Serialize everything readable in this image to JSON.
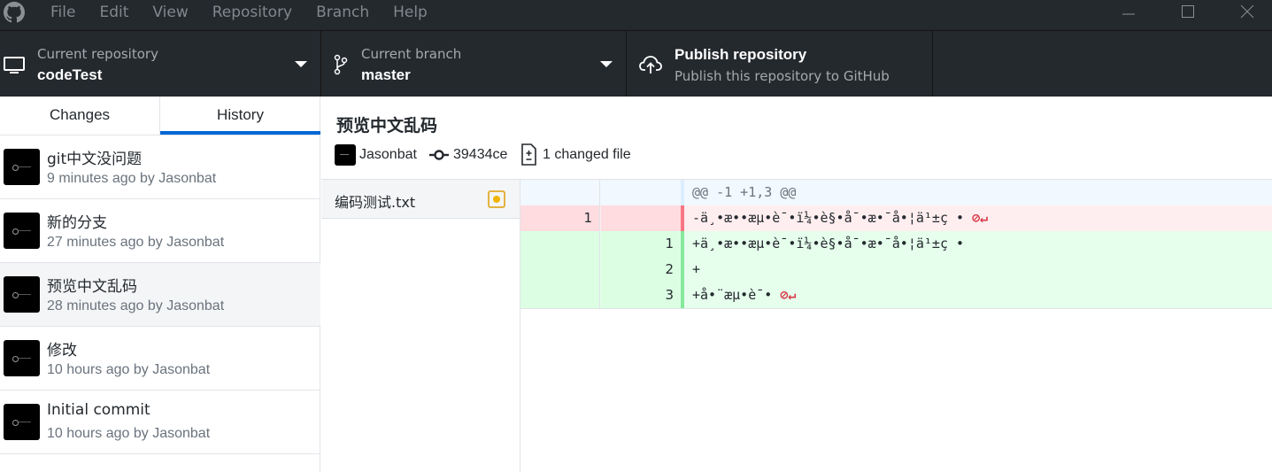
{
  "menu": {
    "items": [
      "File",
      "Edit",
      "View",
      "Repository",
      "Branch",
      "Help"
    ]
  },
  "window_controls": [
    "minimize-icon",
    "maximize-icon",
    "close-icon"
  ],
  "toolbar": {
    "repository": {
      "label": "Current repository",
      "value": "codeTest"
    },
    "branch": {
      "label": "Current branch",
      "value": "master"
    },
    "publish": {
      "label": "Publish repository",
      "sublabel": "Publish this repository to GitHub"
    }
  },
  "tabs": [
    "Changes",
    "History"
  ],
  "active_tab": "History",
  "commits": [
    {
      "title": "git中文没问题",
      "meta": "9 minutes ago by Jasonbat"
    },
    {
      "title": "新的分支",
      "meta": "27 minutes ago by Jasonbat"
    },
    {
      "title": "预览中文乱码",
      "meta": "28 minutes ago by Jasonbat"
    },
    {
      "title": "修改",
      "meta": "10 hours ago by Jasonbat"
    },
    {
      "title": "Initial commit",
      "meta": "10 hours ago by Jasonbat"
    }
  ],
  "selected_commit": {
    "title": "预览中文乱码",
    "author": "Jasonbat",
    "sha": "39434ce",
    "changed_files": "1 changed file"
  },
  "files": [
    {
      "name": "编码测试.txt",
      "status": "modified"
    }
  ],
  "diff": {
    "hunk": "@@ -1 +1,3 @@",
    "lines": [
      {
        "type": "del",
        "old": "1",
        "new": "",
        "text": "-ä¸•æ••æµ•è¯•ï¼•è§•å¯•æ•¯å•¦ä¹±ç •"
      },
      {
        "type": "add",
        "old": "",
        "new": "1",
        "text": "+ä¸•æ••æµ•è¯•ï¼•è§•å¯•æ•¯å•¦ä¹±ç •"
      },
      {
        "type": "add",
        "old": "",
        "new": "2",
        "text": "+"
      },
      {
        "type": "add",
        "old": "",
        "new": "3",
        "text": "+å•¨æµ•è¯•"
      }
    ],
    "colors": {
      "marker": "#d73a49",
      "added_bar": "#85e89d",
      "removed_bar": "#f97583"
    }
  },
  "colors": {
    "accent": "#0366d6",
    "toolbar_bg": "#24292e",
    "modified_badge": "#f0b400"
  }
}
